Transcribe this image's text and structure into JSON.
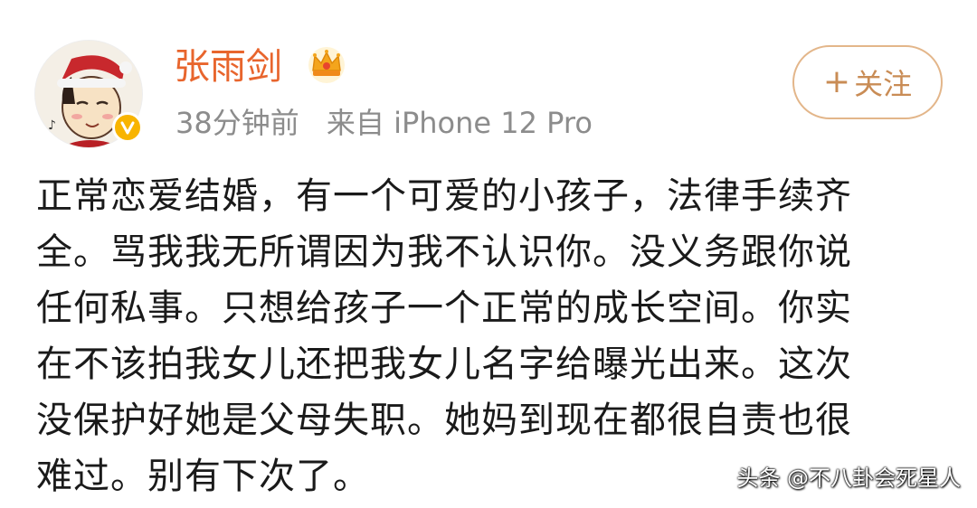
{
  "post": {
    "username": "张雨剑",
    "time": "38分钟前",
    "source": "来自 iPhone 12 Pro",
    "follow_label": "关注",
    "follow_plus": "+",
    "body_lines": [
      "正常恋爱结婚，有一个可爱的小孩子，法律手续齐",
      "全。骂我我无所谓因为我不认识你。没义务跟你说",
      "任何私事。只想给孩子一个正常的成长空间。你实",
      "在不该拍我女儿还把我女儿名字给曝光出来。这次",
      "没保护好她是父母失职。她妈到现在都很自责也很",
      "难过。别有下次了。"
    ]
  },
  "watermark": "头条 @不八卦会死星人",
  "icons": {
    "avatar": "cartoon-avatar-santa-hat",
    "verified": "verified-v-badge",
    "crown": "crown-vip-icon"
  },
  "colors": {
    "username": "#e8652d",
    "meta": "#8c8c8c",
    "follow_border": "#e3b68a",
    "follow_text": "#c98c55",
    "verified_badge": "#f8b400"
  }
}
